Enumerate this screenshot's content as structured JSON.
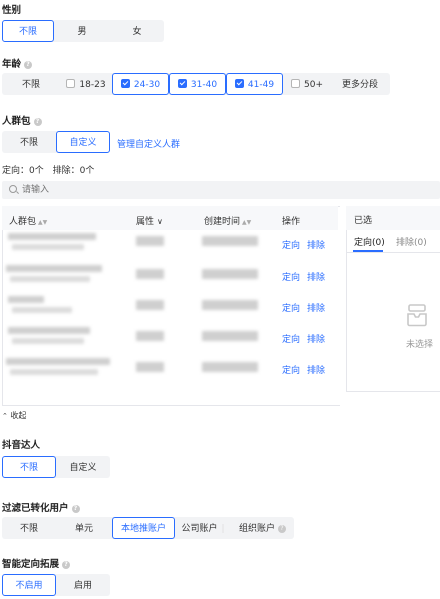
{
  "gender": {
    "label": "性别",
    "options": [
      {
        "label": "不限",
        "selected": true
      },
      {
        "label": "男",
        "selected": false
      },
      {
        "label": "女",
        "selected": false
      }
    ]
  },
  "age": {
    "label": "年龄",
    "any_label": "不限",
    "options": [
      {
        "label": "18-23",
        "checked": false
      },
      {
        "label": "24-30",
        "checked": true
      },
      {
        "label": "31-40",
        "checked": true
      },
      {
        "label": "41-49",
        "checked": true
      },
      {
        "label": "50+",
        "checked": false
      }
    ],
    "more_label": "更多分段"
  },
  "crowd": {
    "label": "人群包",
    "options": [
      {
        "label": "不限",
        "selected": false
      },
      {
        "label": "自定义",
        "selected": true
      }
    ],
    "manage_link": "管理自定义人群",
    "counts": {
      "target_label": "定向：",
      "target_value": "0个",
      "exclude_label": "排除：",
      "exclude_value": "0个"
    },
    "search_placeholder": "请输入",
    "table": {
      "headers": {
        "name": "人群包",
        "attr": "属性",
        "created": "创建时间",
        "action": "操作"
      },
      "row_actions": {
        "target": "定向",
        "exclude": "排除"
      },
      "rows": 5
    },
    "selected_panel": {
      "title": "已选",
      "tabs": [
        {
          "label": "定向(0)",
          "active": true
        },
        {
          "label": "排除(0)",
          "active": false
        }
      ],
      "empty_text": "未选择"
    },
    "collapse_label": "收起"
  },
  "douyin": {
    "label": "抖音达人",
    "options": [
      {
        "label": "不限",
        "selected": true
      },
      {
        "label": "自定义",
        "selected": false
      }
    ]
  },
  "filter": {
    "label": "过滤已转化用户",
    "options": [
      {
        "label": "不限",
        "selected": false
      },
      {
        "label": "单元",
        "selected": false
      },
      {
        "label": "本地推账户",
        "selected": true
      },
      {
        "label": "公司账户",
        "selected": false
      },
      {
        "label": "组织账户",
        "selected": false
      }
    ]
  },
  "smart": {
    "label": "智能定向拓展",
    "options": [
      {
        "label": "不启用",
        "selected": true
      },
      {
        "label": "启用",
        "selected": false
      }
    ]
  },
  "colors": {
    "accent": "#2a6dff",
    "segment_bg": "#f2f3f5",
    "border": "#e5e6eb"
  }
}
